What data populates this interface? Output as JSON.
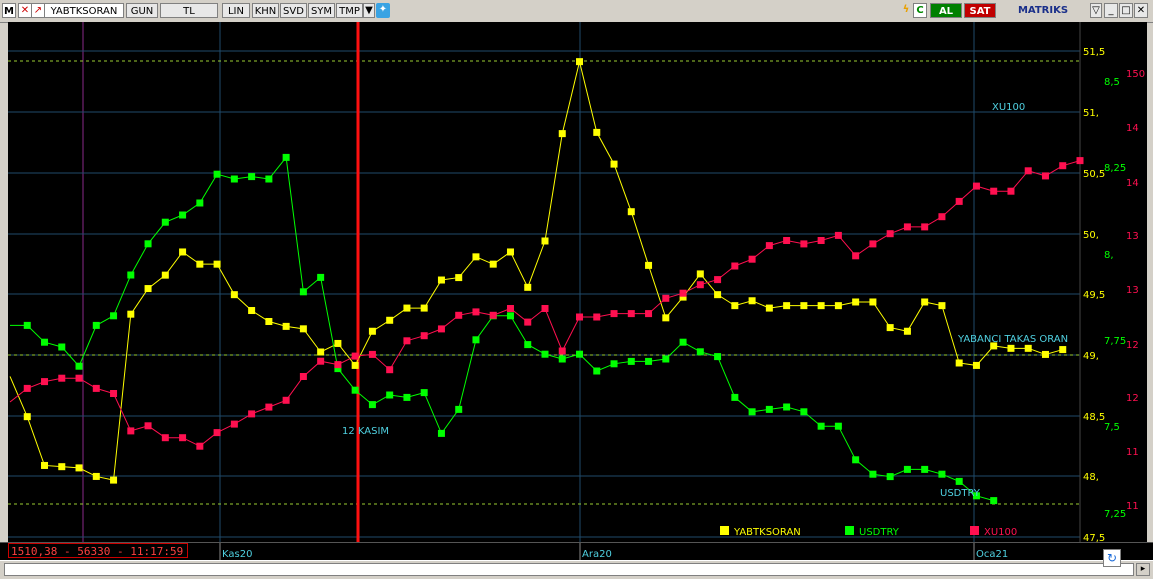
{
  "toolbar": {
    "m_label": "M",
    "symbol": "YABTKSORAN",
    "period": "GUN",
    "currency": "TL",
    "scale": "LIN",
    "buttons": [
      "KHN",
      "SVD",
      "SYM",
      "TMP"
    ],
    "al_label": "AL",
    "sat_label": "SAT",
    "brand": "MATRIKS",
    "c_label": "C"
  },
  "status_text": "1510,38 - 56330 - 11:17:59",
  "annotation_12kasim": "12 KASIM",
  "chart_data": {
    "type": "line",
    "x_labels": [
      "Kas20",
      "Ara20",
      "Oca21"
    ],
    "left_axis_ticks": [
      "51,5",
      "51,",
      "50,5",
      "50,",
      "49,5",
      "49,",
      "48,5",
      "48,",
      "47,5"
    ],
    "mid_axis_ticks": [
      "8,5",
      "8,25",
      "8,",
      "7,75",
      "7,5",
      "7,25"
    ],
    "right_axis_ticks": [
      "150",
      "14",
      "14",
      "13",
      "13",
      "12",
      "12",
      "11",
      "11"
    ],
    "legend": [
      "YABTKSORAN",
      "USDTRY",
      "XU100"
    ],
    "series": [
      {
        "name": "YABTKSORAN",
        "color": "#ffff00",
        "values": [
          48.8,
          48.47,
          48.07,
          48.06,
          48.05,
          47.98,
          47.95,
          49.31,
          49.52,
          49.63,
          49.82,
          49.72,
          49.72,
          49.47,
          49.34,
          49.25,
          49.21,
          49.19,
          49.0,
          49.07,
          48.89,
          49.17,
          49.26,
          49.36,
          49.36,
          49.59,
          49.61,
          49.78,
          49.72,
          49.82,
          49.53,
          49.91,
          50.79,
          51.38,
          50.8,
          50.54,
          50.15,
          49.71,
          49.28,
          49.45,
          49.64,
          49.47,
          49.38,
          49.42,
          49.36,
          49.38,
          49.38,
          49.38,
          49.38,
          49.41,
          49.41,
          49.2,
          49.17,
          49.41,
          49.38,
          48.91,
          48.89,
          49.05,
          49.03,
          49.03,
          48.98,
          49.02
        ]
      },
      {
        "name": "USDTRY",
        "color": "#00ff00",
        "values": [
          7.99,
          7.99,
          7.92,
          7.9,
          7.82,
          7.99,
          8.03,
          8.2,
          8.33,
          8.42,
          8.45,
          8.5,
          8.62,
          8.6,
          8.61,
          8.6,
          8.69,
          8.13,
          8.19,
          7.81,
          7.72,
          7.66,
          7.7,
          7.69,
          7.71,
          7.54,
          7.64,
          7.93,
          8.03,
          8.03,
          7.91,
          7.87,
          7.85,
          7.87,
          7.8,
          7.83,
          7.84,
          7.84,
          7.85,
          7.92,
          7.88,
          7.86,
          7.69,
          7.63,
          7.64,
          7.65,
          7.63,
          7.57,
          7.57,
          7.43,
          7.37,
          7.36,
          7.39,
          7.39,
          7.37,
          7.34,
          7.28,
          7.26
        ]
      },
      {
        "name": "XU100",
        "color": "#ff1050",
        "values": [
          1200,
          1208,
          1212,
          1214,
          1214,
          1208,
          1205,
          1183,
          1186,
          1179,
          1179,
          1174,
          1182,
          1187,
          1193,
          1197,
          1201,
          1215,
          1224,
          1222,
          1227,
          1228,
          1219,
          1236,
          1239,
          1243,
          1251,
          1253,
          1251,
          1255,
          1247,
          1255,
          1230,
          1250,
          1250,
          1252,
          1252,
          1252,
          1261,
          1264,
          1269,
          1272,
          1280,
          1284,
          1292,
          1295,
          1293,
          1295,
          1298,
          1286,
          1293,
          1299,
          1303,
          1303,
          1309,
          1318,
          1327,
          1324,
          1324,
          1336,
          1333,
          1339,
          1342
        ]
      }
    ],
    "annotations": [
      "XU100",
      "YABANCI TAKAS ORAN",
      "USDTRY"
    ],
    "left_range": [
      47.5,
      51.8
    ],
    "grid": true
  }
}
